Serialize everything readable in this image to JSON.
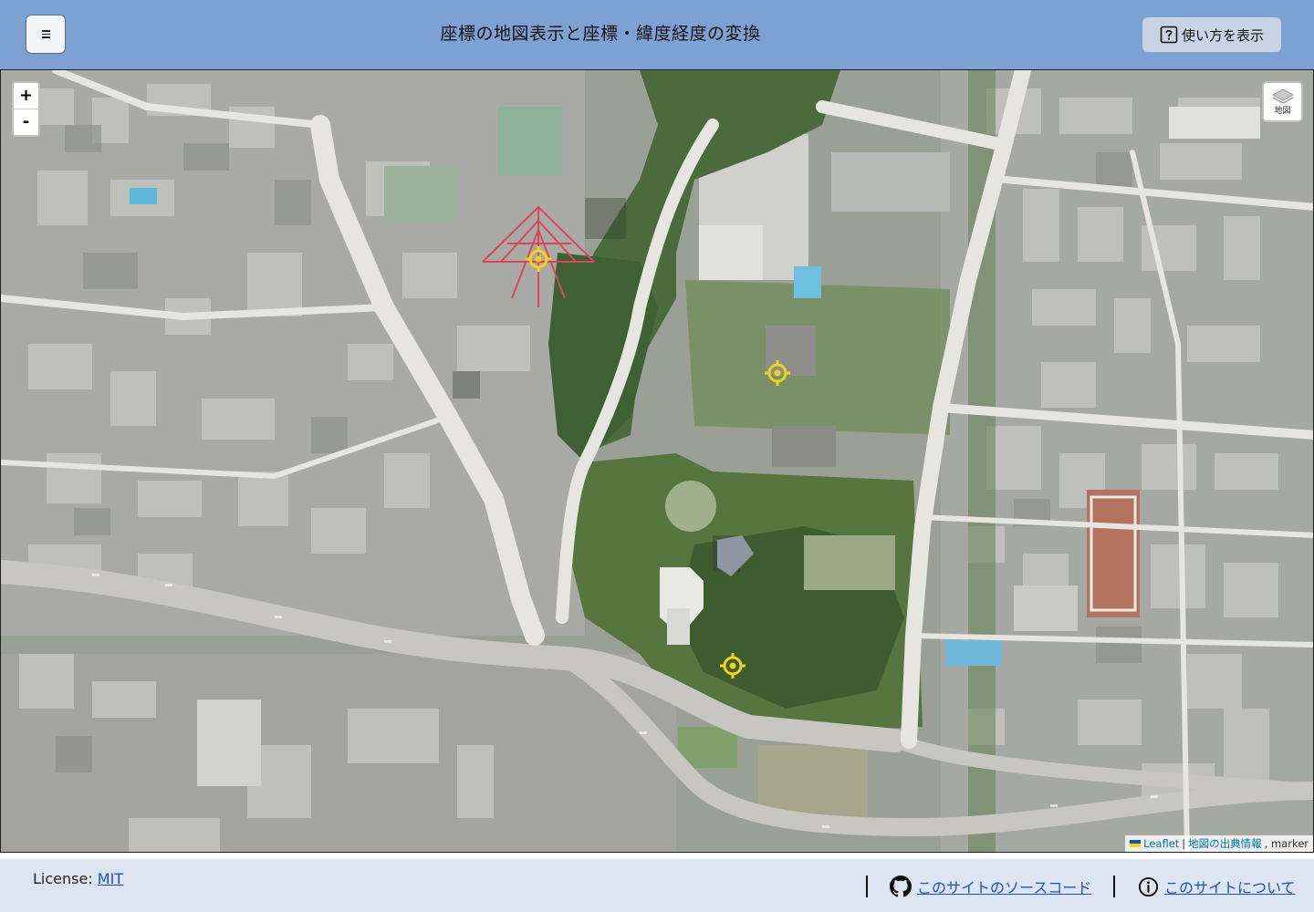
{
  "header": {
    "title": "座標の地図表示と座標・緯度経度の変換",
    "menu_icon": "hamburger-menu-icon",
    "help_button_label": "使い方を表示",
    "help_icon": "question-box-icon",
    "bg_color": "#7ea1d3"
  },
  "map": {
    "zoom_in_label": "+",
    "zoom_out_label": "-",
    "layer_control_label": "地図",
    "layer_icon": "layers-icon",
    "marker_icon": "crosshair-marker-icon",
    "marker_color": "#f2d21b",
    "marker_count": 3,
    "attribution": {
      "leaflet": "Leaflet",
      "separator": "|",
      "source": "地図の出典情報",
      "suffix": ", marker"
    }
  },
  "footer": {
    "license_label": "License: ",
    "license_link": "MIT",
    "source_link": "このサイトのソースコード",
    "source_icon": "github-icon",
    "about_link": "このサイトについて",
    "about_icon": "info-circle-icon",
    "bg_color": "#dde5f0"
  }
}
